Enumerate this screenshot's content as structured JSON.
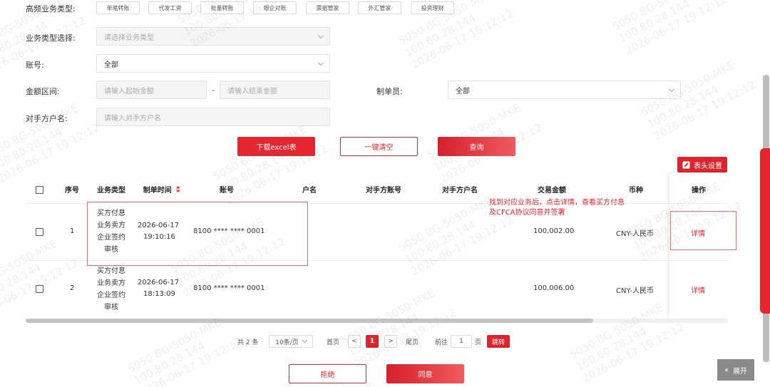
{
  "filters": {
    "quick_label": "高频业务类型:",
    "quick_chips": [
      "单笔转账",
      "代发工资",
      "批量转账",
      "银企对账",
      "票据管家",
      "外汇管家",
      "投资理财"
    ],
    "biz_type_label": "业务类型选择:",
    "biz_type_placeholder": "请选择业务类型",
    "account_label": "账号:",
    "account_value": "全部",
    "amount_label": "金额区间:",
    "amount_start_placeholder": "请输入起始金额",
    "amount_dash": "-",
    "amount_end_placeholder": "请输入结束金额",
    "maker_label": "制单员:",
    "maker_value": "全部",
    "counterparty_label": "对手方户名:",
    "counterparty_placeholder": "请输入对手方户名"
  },
  "actions": {
    "download": "下载excel表",
    "clear": "一键清空",
    "query": "查询",
    "header_settings": "表头设置"
  },
  "table": {
    "headers": {
      "seq": "序号",
      "biz_type": "业务类型",
      "time": "制单时间",
      "account": "账号",
      "name": "户名",
      "cp_account": "对手方账号",
      "cp_name": "对手方户名",
      "amount": "交易金额",
      "currency": "币种",
      "operation": "操作"
    },
    "rows": [
      {
        "seq": "1",
        "biz_type": [
          "买方付息",
          "业务卖方",
          "企业签约",
          "审核"
        ],
        "date": "2026-06-17",
        "time": "19:10:16",
        "account": "8100 **** **** 0001",
        "amount": "100,002.00",
        "currency": "CNY-人民币",
        "op": "详情"
      },
      {
        "seq": "2",
        "biz_type": [
          "买方付息",
          "业务卖方",
          "企业签约",
          "审核"
        ],
        "date": "2026-06-17",
        "time": "18:13:09",
        "account": "8100 **** **** 0001",
        "amount": "100,006.00",
        "currency": "CNY-人民币",
        "op": "详情"
      }
    ]
  },
  "annotation": {
    "line1": "找到对应业务后，点击详情，查看买方付息",
    "line2": "及CFCA协议同意并签署"
  },
  "pagination": {
    "total": "共 2 条",
    "page_size": "10条/页",
    "first": "首页",
    "prev": "<",
    "current": "1",
    "next": ">",
    "last": "尾页",
    "goto_label": "前往",
    "goto_value": "1",
    "page_unit": "页",
    "jump": "跳转"
  },
  "footer": {
    "reject": "拒绝",
    "agree": "同意",
    "expand": "展开",
    "expand_icon": "«"
  },
  "watermark": {
    "line1": "5050  BG-5050-MKE",
    "line2": "100.80.28.144",
    "line3": "2026-06-17  19:12:12"
  },
  "colors": {
    "brand_red": "#e3262f",
    "annotation_red": "#e86a6a"
  }
}
